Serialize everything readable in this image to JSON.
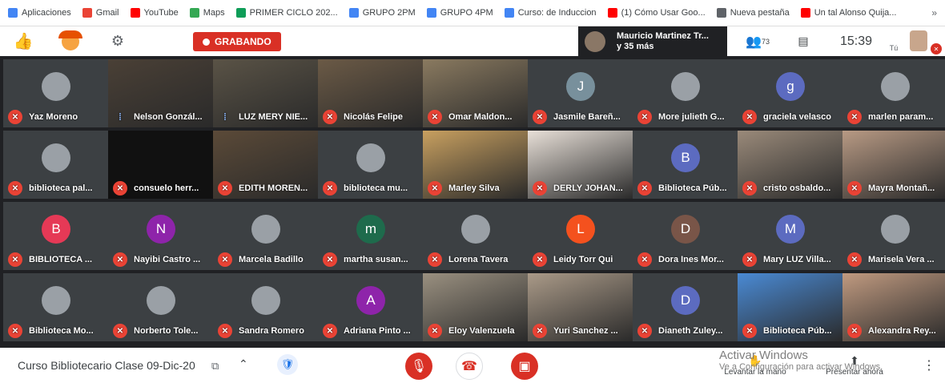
{
  "bookmarks": [
    {
      "label": "Aplicaciones",
      "icon": "apps-grid-icon",
      "color": "#4285f4"
    },
    {
      "label": "Gmail",
      "icon": "gmail-icon",
      "color": "#ea4335"
    },
    {
      "label": "YouTube",
      "icon": "youtube-icon",
      "color": "#ff0000"
    },
    {
      "label": "Maps",
      "icon": "maps-pin-icon",
      "color": "#34a853"
    },
    {
      "label": "PRIMER CICLO 202...",
      "icon": "green-square-icon",
      "color": "#0f9d58"
    },
    {
      "label": "GRUPO 2PM",
      "icon": "blue-circle-icon",
      "color": "#4285f4"
    },
    {
      "label": "GRUPO 4PM",
      "icon": "blue-circle-icon",
      "color": "#4285f4"
    },
    {
      "label": "Curso: de Induccion",
      "icon": "blue-circle-icon",
      "color": "#4285f4"
    },
    {
      "label": "(1) Cómo Usar Goo...",
      "icon": "youtube-icon",
      "color": "#ff0000"
    },
    {
      "label": "Nueva pestaña",
      "icon": "chrome-icon",
      "color": "#5f6368"
    },
    {
      "label": "Un tal Alonso Quija...",
      "icon": "youtube-icon",
      "color": "#ff0000"
    }
  ],
  "bookmarks_more": "»",
  "recording_label": "GRABANDO",
  "presenter": {
    "name": "Mauricio Martinez Tr...",
    "others": "y 35 más"
  },
  "participants_count": "73",
  "clock": "15:39",
  "self_label": "Tú",
  "tiles": [
    {
      "name": "Yaz Moreno",
      "row": 0,
      "col": 0,
      "kind": "photo",
      "initial": ""
    },
    {
      "name": "Nelson Gonzál...",
      "row": 0,
      "col": 1,
      "kind": "video",
      "speaking": true,
      "bg": "#4a4036"
    },
    {
      "name": "LUZ MERY NIE...",
      "row": 0,
      "col": 2,
      "kind": "video",
      "speaking": true,
      "bg": "#5a5346"
    },
    {
      "name": "Nicolás Felipe",
      "row": 0,
      "col": 3,
      "kind": "video",
      "bg": "#6b5a46"
    },
    {
      "name": "Omar Maldon...",
      "row": 0,
      "col": 4,
      "kind": "video",
      "bg": "#8a7a60"
    },
    {
      "name": "Jasmile Bareñ...",
      "row": 0,
      "col": 5,
      "kind": "letter",
      "initial": "J",
      "color": "#78909c"
    },
    {
      "name": "More julieth G...",
      "row": 0,
      "col": 6,
      "kind": "photo",
      "initial": ""
    },
    {
      "name": "graciela velasco",
      "row": 0,
      "col": 7,
      "kind": "letter",
      "initial": "g",
      "color": "#5c6bc0"
    },
    {
      "name": "marlen param...",
      "row": 0,
      "col": 8,
      "kind": "photo",
      "initial": ""
    },
    {
      "name": "biblioteca pal...",
      "row": 1,
      "col": 0,
      "kind": "photo",
      "initial": ""
    },
    {
      "name": "consuelo herr...",
      "row": 1,
      "col": 1,
      "kind": "dark",
      "initial": ""
    },
    {
      "name": "EDITH MOREN...",
      "row": 1,
      "col": 2,
      "kind": "video",
      "bg": "#5b4a38"
    },
    {
      "name": "biblioteca mu...",
      "row": 1,
      "col": 3,
      "kind": "photo",
      "initial": ""
    },
    {
      "name": "Marley Silva",
      "row": 1,
      "col": 4,
      "kind": "video",
      "bg": "#c8a060"
    },
    {
      "name": "DERLY JOHAN...",
      "row": 1,
      "col": 5,
      "kind": "video",
      "bg": "#e8e0d8"
    },
    {
      "name": "Biblioteca Púb...",
      "row": 1,
      "col": 6,
      "kind": "letter",
      "initial": "B",
      "color": "#5c6bc0"
    },
    {
      "name": "cristo osbaldo...",
      "row": 1,
      "col": 7,
      "kind": "video",
      "bg": "#9a8a7a"
    },
    {
      "name": "Mayra Montañ...",
      "row": 1,
      "col": 8,
      "kind": "video",
      "bg": "#b89a84"
    },
    {
      "name": "BIBLIOTECA ...",
      "row": 2,
      "col": 0,
      "kind": "letter",
      "initial": "B",
      "color": "#e53956"
    },
    {
      "name": "Nayibi Castro ...",
      "row": 2,
      "col": 1,
      "kind": "letter",
      "initial": "N",
      "color": "#8e24aa"
    },
    {
      "name": "Marcela Badillo",
      "row": 2,
      "col": 2,
      "kind": "photo",
      "initial": ""
    },
    {
      "name": "martha susan...",
      "row": 2,
      "col": 3,
      "kind": "letter",
      "initial": "m",
      "color": "#1e6b4c"
    },
    {
      "name": "Lorena Tavera",
      "row": 2,
      "col": 4,
      "kind": "photo",
      "initial": ""
    },
    {
      "name": "Leidy Torr Qui",
      "row": 2,
      "col": 5,
      "kind": "letter",
      "initial": "L",
      "color": "#f4511e"
    },
    {
      "name": "Dora Ines Mor...",
      "row": 2,
      "col": 6,
      "kind": "letter",
      "initial": "D",
      "color": "#795548"
    },
    {
      "name": "Mary LUZ Villa...",
      "row": 2,
      "col": 7,
      "kind": "letter",
      "initial": "M",
      "color": "#5c6bc0"
    },
    {
      "name": "Marisela Vera ...",
      "row": 2,
      "col": 8,
      "kind": "photo",
      "initial": ""
    },
    {
      "name": "Biblioteca Mo...",
      "row": 3,
      "col": 0,
      "kind": "photo",
      "initial": ""
    },
    {
      "name": "Norberto Tole...",
      "row": 3,
      "col": 1,
      "kind": "photo",
      "initial": ""
    },
    {
      "name": "Sandra Romero",
      "row": 3,
      "col": 2,
      "kind": "photo",
      "initial": ""
    },
    {
      "name": "Adriana Pinto ...",
      "row": 3,
      "col": 3,
      "kind": "letter",
      "initial": "A",
      "color": "#8e24aa"
    },
    {
      "name": "Eloy Valenzuela",
      "row": 3,
      "col": 4,
      "kind": "video",
      "bg": "#9a9080"
    },
    {
      "name": "Yuri Sanchez ...",
      "row": 3,
      "col": 5,
      "kind": "video",
      "bg": "#aa9a88"
    },
    {
      "name": "Dianeth Zuley...",
      "row": 3,
      "col": 6,
      "kind": "letter",
      "initial": "D",
      "color": "#5c6bc0"
    },
    {
      "name": "Biblioteca Púb...",
      "row": 3,
      "col": 7,
      "kind": "video",
      "bg": "#4a8ad4"
    },
    {
      "name": "Alexandra Rey...",
      "row": 3,
      "col": 8,
      "kind": "video",
      "bg": "#c09a80"
    }
  ],
  "meeting_title": "Curso Bibliotecario Clase 09-Dic-20",
  "windows_watermark": {
    "line1": "Activar Windows",
    "line2": "Ve a Configuración para activar Windows."
  },
  "actions": {
    "raise_hand": "Levantar la mano",
    "present": "Presentar ahora"
  }
}
